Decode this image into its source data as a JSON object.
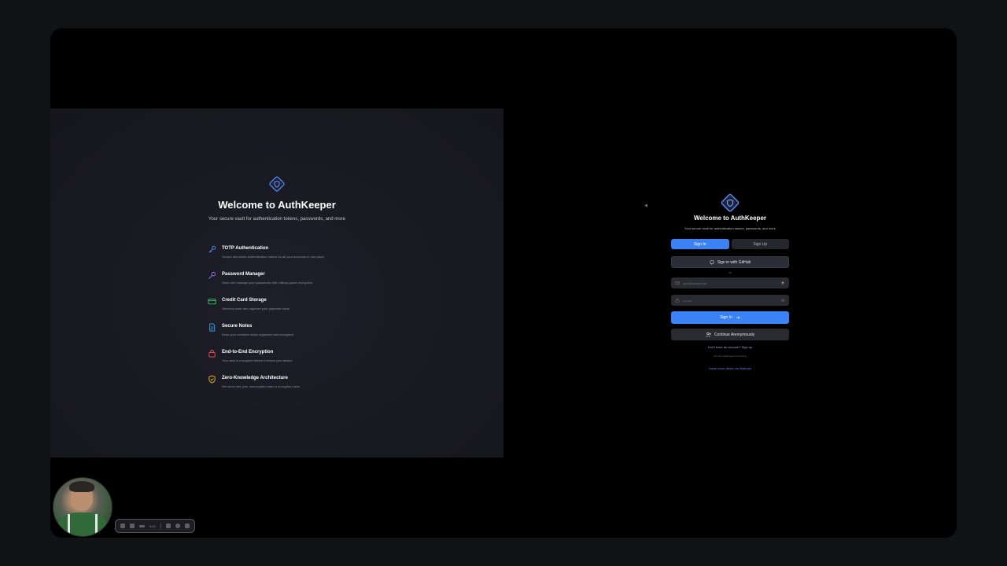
{
  "left": {
    "title": "Welcome to AuthKeeper",
    "subtitle": "Your secure vault for authentication tokens, passwords, and more",
    "features": [
      {
        "title": "TOTP Authentication",
        "desc": "Secure two-factor authentication tokens for all your accounts in one place",
        "icon": "key-icon",
        "color": "#4f8df7"
      },
      {
        "title": "Password Manager",
        "desc": "Store and manage your passwords with military-grade encryption",
        "icon": "password-key-icon",
        "color": "#a36cf5"
      },
      {
        "title": "Credit Card Storage",
        "desc": "Securely store and organize your payment cards",
        "icon": "credit-card-icon",
        "color": "#34c46a"
      },
      {
        "title": "Secure Notes",
        "desc": "Keep your sensitive notes organized and encrypted",
        "icon": "document-icon",
        "color": "#36a8f0"
      },
      {
        "title": "End-to-End Encryption",
        "desc": "Your data is encrypted before it leaves your device",
        "icon": "lock-icon",
        "color": "#f05252"
      },
      {
        "title": "Zero-Knowledge Architecture",
        "desc": "We never see your unencrypted data or encryption keys",
        "icon": "shield-check-icon",
        "color": "#f0b429"
      }
    ],
    "toolbar_time": "0:00"
  },
  "right": {
    "title": "Welcome to AuthKeeper",
    "subtitle": "Your secure vault for authentication tokens, passwords, and more",
    "tab_signin": "Sign In",
    "tab_signup": "Sign Up",
    "github_label": "Sign in with GitHub",
    "or_label": "or",
    "email_placeholder": "your@email.com",
    "password_value": "••••••••",
    "signin_label": "Sign In",
    "anon_label": "Continue Anonymously",
    "no_account": "Don't have an account? Sign up",
    "community": "Join the AuthKeeper community",
    "learn_more": "Learn more about our features"
  },
  "colors": {
    "accent": "#3b82f6",
    "logo": "#5b8def"
  }
}
